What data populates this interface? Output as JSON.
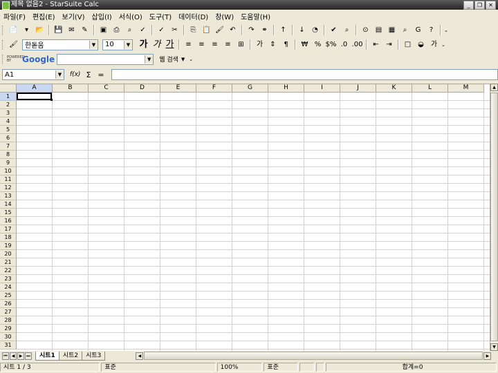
{
  "window": {
    "title": "제목 없음2 - StarSuite Calc",
    "minimize_glyph": "_",
    "restore_glyph": "❐",
    "close_glyph": "✕"
  },
  "menu": [
    "파일(F)",
    "편집(E)",
    "보기(V)",
    "삽입(I)",
    "서식(O)",
    "도구(T)",
    "데이터(D)",
    "창(W)",
    "도움말(H)"
  ],
  "toolbar1": {
    "icons": [
      {
        "name": "new-document-icon",
        "glyph": "📄"
      },
      {
        "name": "new-dropdown-icon",
        "glyph": "▾"
      },
      {
        "name": "open-icon",
        "glyph": "📂"
      },
      {
        "name": "save-icon",
        "glyph": "💾"
      },
      {
        "name": "email-icon",
        "glyph": "✉"
      },
      {
        "name": "edit-file-icon",
        "glyph": "✎"
      },
      {
        "name": "export-pdf-icon",
        "glyph": "▣"
      },
      {
        "name": "print-icon",
        "glyph": "⎙"
      },
      {
        "name": "print-preview-icon",
        "glyph": "⌕"
      },
      {
        "name": "spellcheck-icon",
        "glyph": "✓"
      },
      {
        "name": "autospell-icon",
        "glyph": "✓"
      },
      {
        "name": "cut-icon",
        "glyph": "✂"
      },
      {
        "name": "copy-icon",
        "glyph": "⎘"
      },
      {
        "name": "paste-icon",
        "glyph": "📋"
      },
      {
        "name": "format-paintbrush-icon",
        "glyph": "🖌"
      },
      {
        "name": "undo-icon",
        "glyph": "↶"
      },
      {
        "name": "redo-icon",
        "glyph": "↷"
      },
      {
        "name": "hyperlink-icon",
        "glyph": "⚭"
      },
      {
        "name": "sort-ascending-icon",
        "glyph": "↑"
      },
      {
        "name": "sort-descending-icon",
        "glyph": "↓"
      },
      {
        "name": "chart-icon",
        "glyph": "◔"
      },
      {
        "name": "show-draw-icon",
        "glyph": "✔"
      },
      {
        "name": "find-replace-icon",
        "glyph": "⌕"
      },
      {
        "name": "navigator-icon",
        "glyph": "⊙"
      },
      {
        "name": "gallery-icon",
        "glyph": "▤"
      },
      {
        "name": "data-sources-icon",
        "glyph": "▦"
      },
      {
        "name": "zoom-icon",
        "glyph": "⌕"
      },
      {
        "name": "google-icon",
        "glyph": "G"
      },
      {
        "name": "help-icon",
        "glyph": "?"
      }
    ]
  },
  "toolbar2": {
    "font_name": "한돋움",
    "font_size": "10",
    "bold": "가",
    "italic": "가",
    "underline": "가",
    "icons_after": [
      {
        "name": "align-left-icon",
        "glyph": "≡"
      },
      {
        "name": "align-center-icon",
        "glyph": "≡"
      },
      {
        "name": "align-right-icon",
        "glyph": "≡"
      },
      {
        "name": "justify-icon",
        "glyph": "≡"
      },
      {
        "name": "merge-cells-icon",
        "glyph": "⊞"
      },
      {
        "name": "wrap-text-icon",
        "glyph": "가"
      },
      {
        "name": "vertical-text-icon",
        "glyph": "⇕"
      },
      {
        "name": "text-direction-icon",
        "glyph": "¶"
      },
      {
        "name": "currency-icon",
        "glyph": "₩"
      },
      {
        "name": "percent-icon",
        "glyph": "%"
      },
      {
        "name": "number-format-icon",
        "glyph": "$%"
      },
      {
        "name": "add-decimal-icon",
        "glyph": ".0"
      },
      {
        "name": "delete-decimal-icon",
        "glyph": ".00"
      },
      {
        "name": "decrease-indent-icon",
        "glyph": "⇤"
      },
      {
        "name": "increase-indent-icon",
        "glyph": "⇥"
      },
      {
        "name": "borders-icon",
        "glyph": "□"
      },
      {
        "name": "background-color-icon",
        "glyph": "◒"
      },
      {
        "name": "font-color-icon",
        "glyph": "가"
      }
    ]
  },
  "toolbar3": {
    "google_label_powered": "POWERED BY",
    "google_label": "Google",
    "search_value": "",
    "web_search_label": "웹 검색"
  },
  "formula": {
    "name_box": "A1",
    "function_wizard": "f(x)",
    "sum": "Σ",
    "equals": "=",
    "value": ""
  },
  "sheet": {
    "columns": [
      "A",
      "B",
      "C",
      "D",
      "E",
      "F",
      "G",
      "H",
      "I",
      "J",
      "K",
      "L",
      "M"
    ],
    "rows": [
      "1",
      "2",
      "3",
      "4",
      "5",
      "6",
      "7",
      "8",
      "9",
      "10",
      "11",
      "12",
      "13",
      "14",
      "15",
      "16",
      "17",
      "18",
      "19",
      "20",
      "21",
      "22",
      "23",
      "24",
      "25",
      "26",
      "27",
      "28",
      "29",
      "30",
      "31"
    ],
    "selected_cell": "A1"
  },
  "tabs": [
    "시트1",
    "시트2",
    "시트3"
  ],
  "status": {
    "sheet": "시트 1 / 3",
    "style": "표준",
    "zoom": "100%",
    "mode": "표준",
    "sum": "합계=0"
  }
}
